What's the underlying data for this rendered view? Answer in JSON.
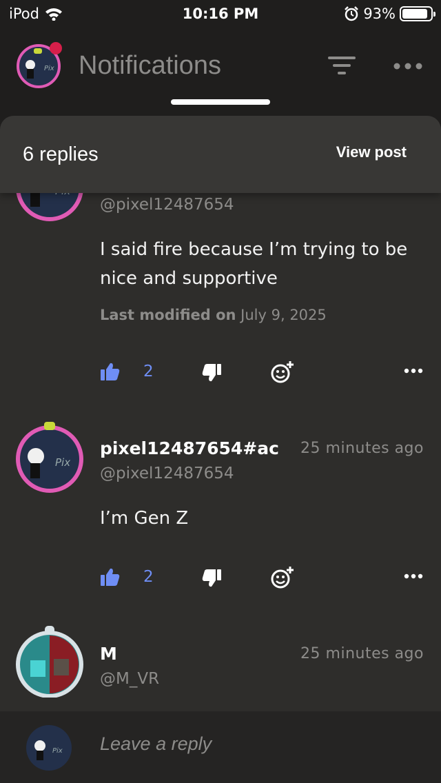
{
  "status_bar": {
    "carrier": "iPod",
    "time": "10:16 PM",
    "battery": "93%"
  },
  "header": {
    "title": "Notifications"
  },
  "sheet": {
    "replies_count": "6 replies",
    "view_post_label": "View post"
  },
  "comments": [
    {
      "handle": "@pixel12487654",
      "text": "I said fire because I’m trying to be nice and supportive",
      "modified_label": "Last modified on",
      "modified_date": "July 9, 2025",
      "likes": "2"
    },
    {
      "author": "pixel12487654#ac",
      "handle": "@pixel12487654",
      "time_ago": "25 minutes ago",
      "text": "I’m Gen Z",
      "likes": "2"
    },
    {
      "author": "M",
      "handle": "@M_VR",
      "time_ago": "25 minutes ago"
    }
  ],
  "composer": {
    "placeholder": "Leave a reply"
  },
  "icons": [
    "wifi-icon",
    "alarm-icon",
    "battery-icon",
    "filter-icon",
    "more-icon",
    "thumbs-up-icon",
    "thumbs-down-icon",
    "add-reaction-icon"
  ],
  "colors": {
    "background": "#1f1e1d",
    "sheet": "#2e2d2b",
    "accent": "#6f8ef5",
    "muted": "#8d8c8a",
    "avatar_ring": "#e05bb5"
  }
}
